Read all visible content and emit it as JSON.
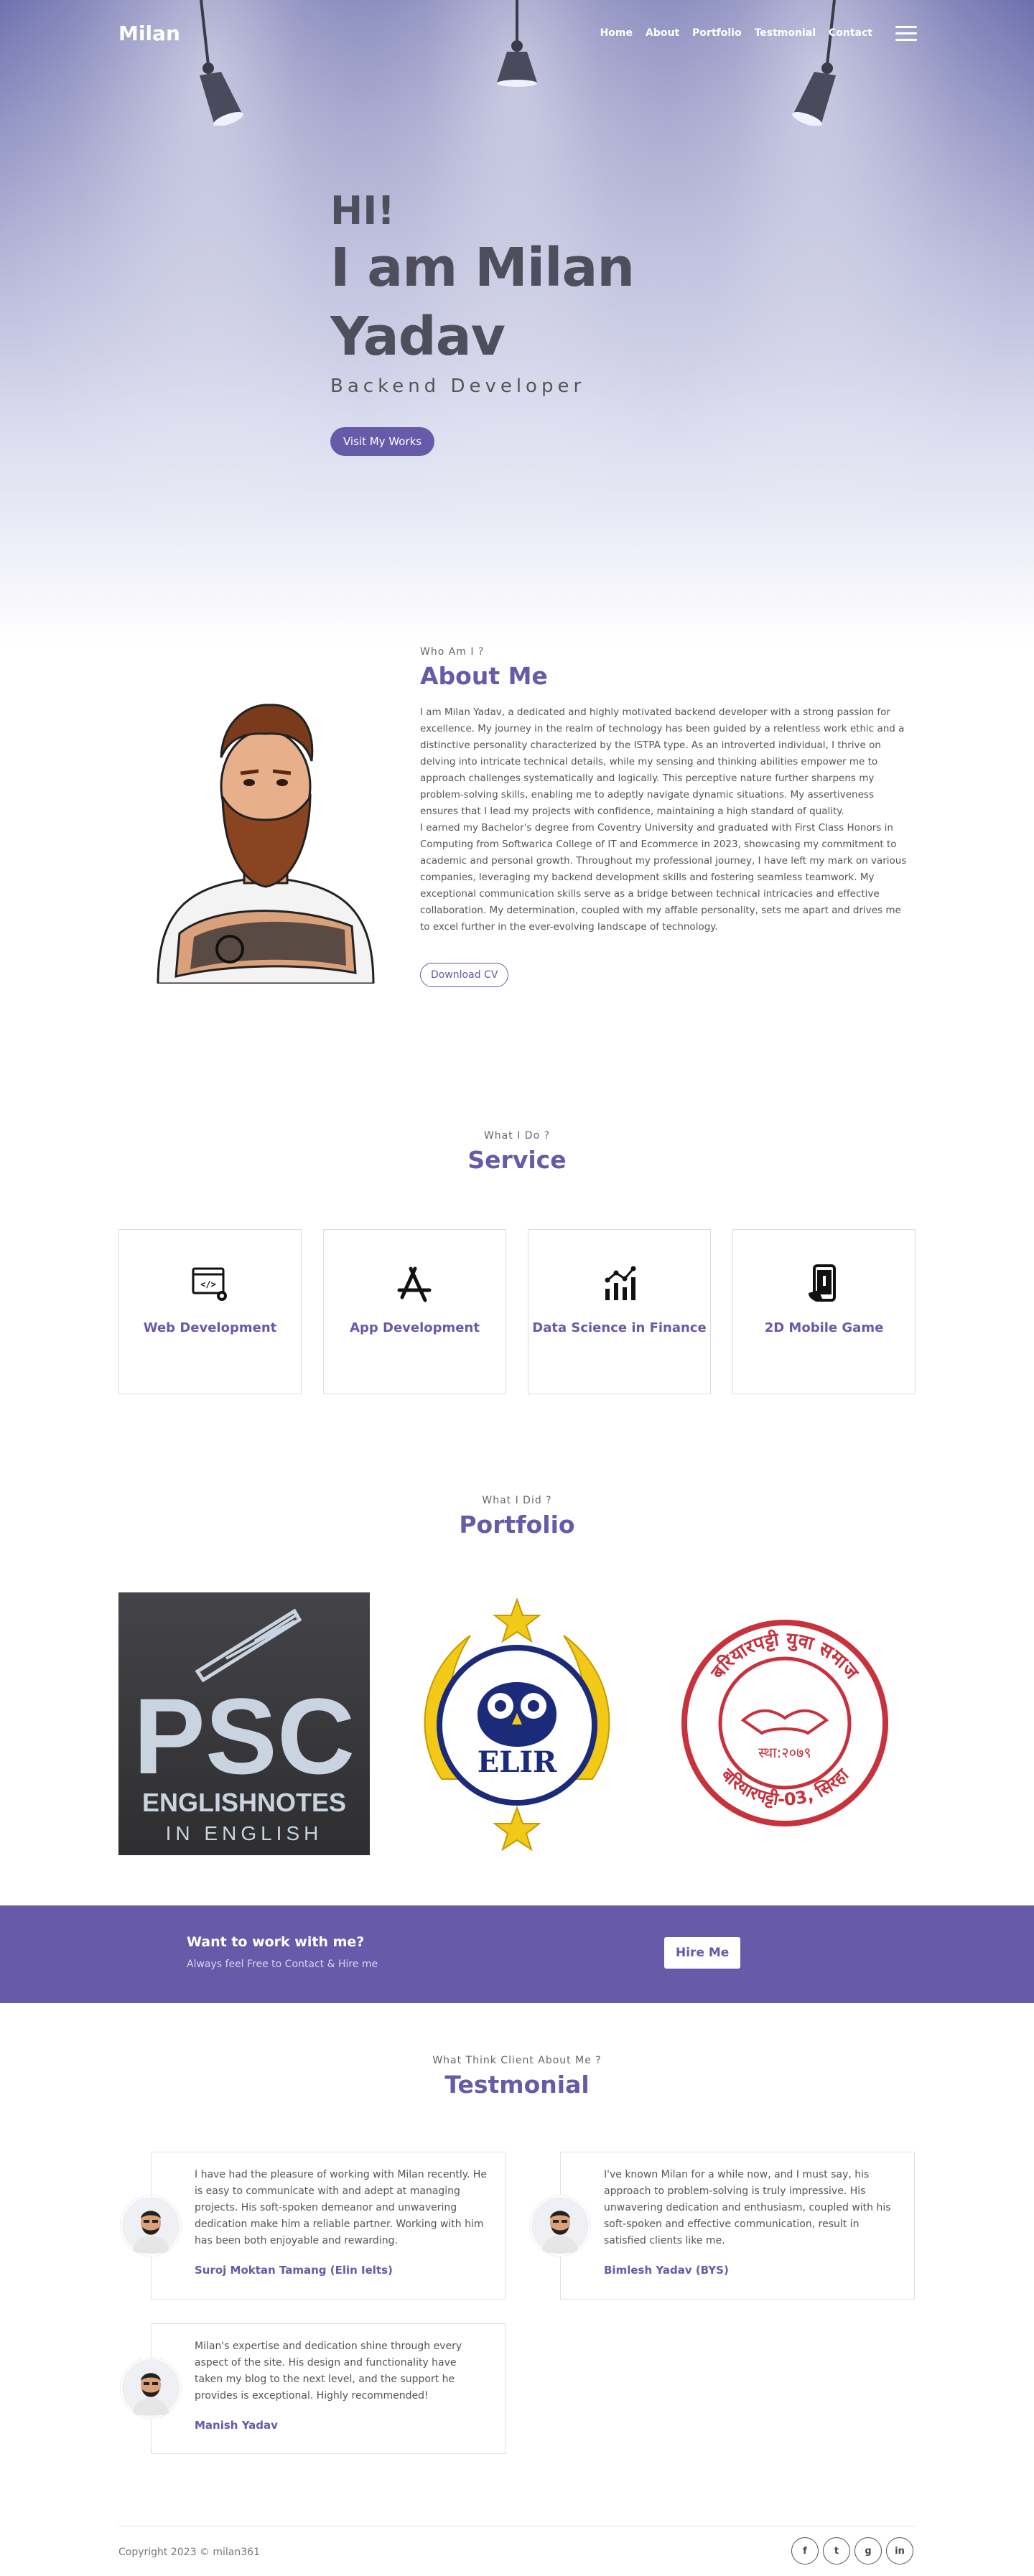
{
  "nav": {
    "brand": "Milan",
    "links": [
      "Home",
      "About",
      "Portfolio",
      "Testmonial",
      "Contact"
    ],
    "menu_icon": "hamburger-icon"
  },
  "hero": {
    "greeting": "HI!",
    "name": "I am Milan Yadav",
    "role": "Backend Developer",
    "cta": "Visit My Works"
  },
  "about": {
    "eyebrow": "Who Am I ?",
    "title": "About Me",
    "para1": "I am Milan Yadav, a dedicated and highly motivated backend developer with a strong passion for excellence. My journey in the realm of technology has been guided by a relentless work ethic and a distinctive personality characterized by the ISTPA type. As an introverted individual, I thrive on delving into intricate technical details, while my sensing and thinking abilities empower me to approach challenges systematically and logically. This perceptive nature further sharpens my problem-solving skills, enabling me to adeptly navigate dynamic situations. My assertiveness ensures that I lead my projects with confidence, maintaining a high standard of quality.",
    "para2": "I earned my Bachelor's degree from Coventry University and graduated with First Class Honors in Computing from Softwarica College of IT and Ecommerce in 2023, showcasing my commitment to academic and personal growth. Throughout my professional journey, I have left my mark on various companies, leveraging my backend development skills and fostering seamless teamwork. My exceptional communication skills serve as a bridge between technical intricacies and effective collaboration. My determination, coupled with my affable personality, sets me apart and drives me to excel further in the ever-evolving landscape of technology.",
    "download": "Download CV"
  },
  "service": {
    "eyebrow": "What I Do ?",
    "title": "Service",
    "items": [
      {
        "label": "Web Development",
        "icon": "code-browser-icon"
      },
      {
        "label": "App Development",
        "icon": "app-store-icon"
      },
      {
        "label": "Data Science in Finance",
        "icon": "chart-icon"
      },
      {
        "label": "2D Mobile Game",
        "icon": "mobile-game-icon"
      }
    ]
  },
  "portfolio": {
    "eyebrow": "What I Did ?",
    "title": "Portfolio",
    "items": [
      {
        "logo_top": "PSC",
        "logo_mid": "ENGLISHNOTES",
        "logo_bot": "IN ENGLISH"
      },
      {
        "logo_text": "ELIR"
      },
      {
        "logo_text": "बरियारपट्टी युवा समाज",
        "logo_sub": "बरियारपट्टी-03, सिरहा",
        "logo_year": "स्था:२०७९"
      }
    ]
  },
  "cta": {
    "title": "Want to work with me?",
    "subtitle": "Always feel Free to Contact & Hire me",
    "button": "Hire Me"
  },
  "testimonial": {
    "eyebrow": "What Think Client About Me ?",
    "title": "Testmonial",
    "items": [
      {
        "quote": "I have had the pleasure of working with Milan recently. He is easy to communicate with and adept at managing projects. His soft-spoken demeanor and unwavering dedication make him a reliable partner. Working with him has been both enjoyable and rewarding.",
        "name": "Suroj Moktan Tamang (Elin Ielts)"
      },
      {
        "quote": "I've known Milan for a while now, and I must say, his approach to problem-solving is truly impressive. His unwavering dedication and enthusiasm, coupled with his soft-spoken and effective communication, result in satisfied clients like me.",
        "name": "Bimlesh Yadav (BYS)"
      },
      {
        "quote": "Milan's expertise and dedication shine through every aspect of the site. His design and functionality have taken my blog to the next level, and the support he provides is exceptional. Highly recommended!",
        "name": "Manish Yadav"
      }
    ]
  },
  "footer": {
    "copyright": "Copyright 2023 © milan361",
    "socials": [
      {
        "icon": "facebook-icon",
        "glyph": "f"
      },
      {
        "icon": "twitter-icon",
        "glyph": "t"
      },
      {
        "icon": "github-icon",
        "glyph": "g"
      },
      {
        "icon": "linkedin-icon",
        "glyph": "in"
      }
    ]
  },
  "colors": {
    "accent": "#675aa8",
    "hero_top": "#6d6fae"
  }
}
